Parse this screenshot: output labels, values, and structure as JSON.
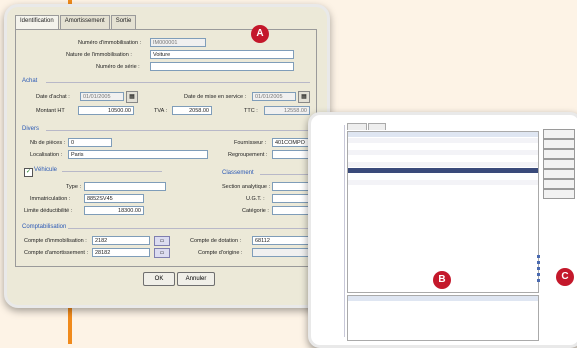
{
  "tabs": [
    "Identification",
    "Amortissement",
    "Sortie"
  ],
  "ident": {
    "numero_label": "Numéro d'immobilisation :",
    "numero_value": "IM000001",
    "nature_label": "Nature de l'immobilisation :",
    "nature_value": "Voiture",
    "serie_label": "Numéro de série :",
    "serie_value": ""
  },
  "achat": {
    "section": "Achat",
    "date_label": "Date d'achat :",
    "date_value": "01/01/2005",
    "service_label": "Date de mise en service :",
    "service_value": "01/01/2005",
    "montant_label": "Montant HT",
    "montant_value": "10500.00",
    "tva_label": "TVA :",
    "tva_value": "2058.00",
    "ttc_label": "TTC :",
    "ttc_value": "12558.00"
  },
  "divers": {
    "section": "Divers",
    "pieces_label": "Nb de pièces :",
    "pieces_value": "0",
    "fournisseur_label": "Fournisseur :",
    "fournisseur_value": "401COMPO",
    "localisation_label": "Localisation :",
    "localisation_value": "Paris",
    "regroupement_label": "Regroupement :"
  },
  "vehicule": {
    "label": "Véhicule",
    "type_label": "Type :",
    "type_value": "",
    "immat_label": "Immatriculation :",
    "immat_value": "8852SV45",
    "limite_label": "Limite déductibilité :",
    "limite_value": "18300.00"
  },
  "classement": {
    "section": "Classement",
    "analytique_label": "Section analytique :",
    "ugt_label": "U.G.T. :",
    "categorie_label": "Catégorie :"
  },
  "compta": {
    "section": "Comptabilisation",
    "immo_label": "Compte d'immobilisation :",
    "immo_value": "2182",
    "amort_label": "Compte d'amortissement :",
    "amort_value": "28182",
    "dotation_label": "Compte de dotation :",
    "dotation_value": "68112",
    "origine_label": "Compte d'origine :",
    "origine_value": ""
  },
  "buttons": {
    "ok": "OK",
    "cancel": "Annuler"
  },
  "badges": {
    "a": "A",
    "b": "B",
    "c": "C"
  },
  "colors": {
    "badge": "#c4182b",
    "accent_stripe": "#f08a1c",
    "section_text": "#2a58b5"
  }
}
